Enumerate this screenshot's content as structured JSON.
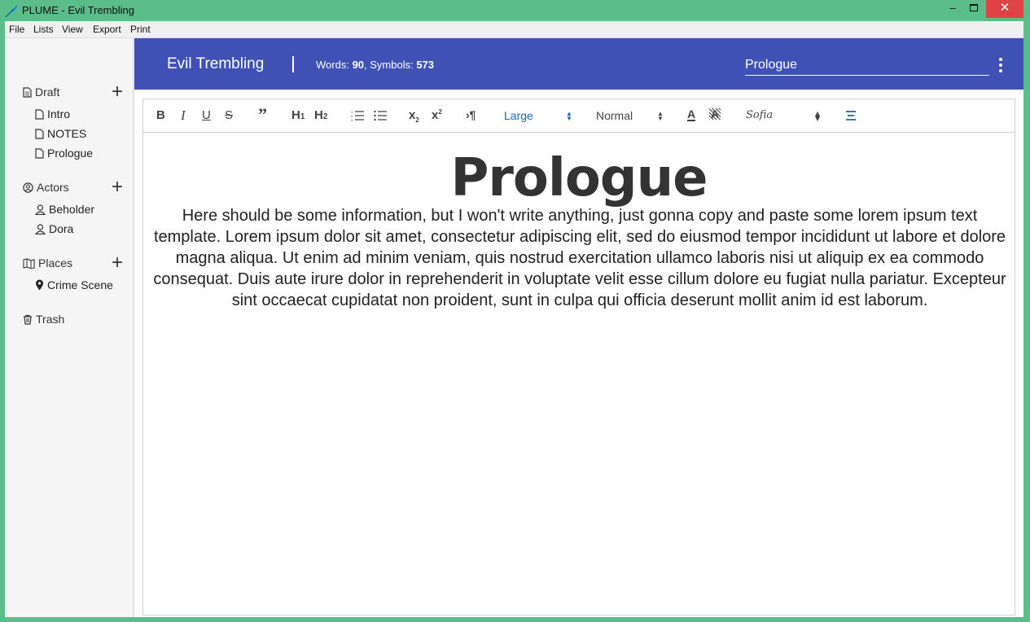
{
  "window": {
    "title": "PLUME - Evil Trembling",
    "minimize": "–",
    "close": "✕",
    "accent": "#5bbd8a"
  },
  "menu": [
    "File",
    "Lists",
    "View",
    "Export",
    "Print"
  ],
  "sidebar": {
    "sections": [
      {
        "label": "Draft",
        "icon": "document-icon",
        "items": [
          {
            "label": "Intro",
            "icon": "document-icon"
          },
          {
            "label": "NOTES",
            "icon": "document-icon"
          },
          {
            "label": "Prologue",
            "icon": "document-icon"
          }
        ]
      },
      {
        "label": "Actors",
        "icon": "user-circle-icon",
        "items": [
          {
            "label": "Beholder",
            "icon": "user-icon"
          },
          {
            "label": "Dora",
            "icon": "user-icon"
          }
        ]
      },
      {
        "label": "Places",
        "icon": "map-icon",
        "items": [
          {
            "label": "Crime Scene",
            "icon": "map-pin-icon"
          }
        ]
      }
    ],
    "trash": "Trash"
  },
  "header": {
    "project_title": "Evil Trembling",
    "words_label": "Words: ",
    "words": "90",
    "symbols_label": ", Symbols: ",
    "symbols": "573",
    "chapter_value": "Prologue",
    "color": "#3f51b5"
  },
  "toolbar": {
    "size_select": "Large",
    "style_select": "Normal",
    "font_select": "Sofia",
    "paragraph": "¶"
  },
  "document": {
    "heading": "Prologue",
    "body": "Here should be some information, but I won't write anything, just gonna copy and paste some lorem ipsum text template. Lorem ipsum dolor sit amet, consectetur adipiscing elit, sed do eiusmod tempor incididunt ut labore et dolore magna aliqua. Ut enim ad minim veniam, quis nostrud exercitation ullamco laboris nisi ut aliquip ex ea commodo consequat. Duis aute irure dolor in reprehenderit in voluptate velit esse cillum dolore eu fugiat nulla pariatur. Excepteur sint occaecat cupidatat non proident, sunt in culpa qui officia deserunt mollit anim id est laborum."
  }
}
